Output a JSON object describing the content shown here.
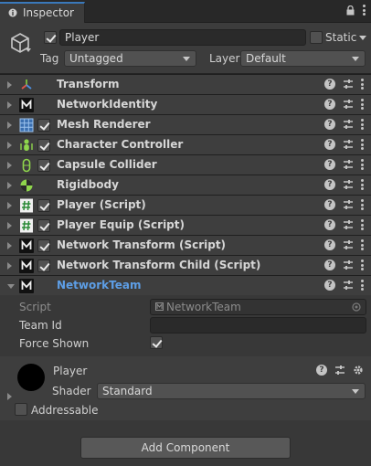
{
  "tab": {
    "label": "Inspector"
  },
  "header": {
    "object_name": "Player",
    "static_label": "Static",
    "tag_label": "Tag",
    "tag_value": "Untagged",
    "layer_label": "Layer",
    "layer_value": "Default",
    "active_checked": true,
    "static_checked": false
  },
  "components": [
    {
      "name": "Transform",
      "icon": "transform-icon",
      "checkbox": null
    },
    {
      "name": "NetworkIdentity",
      "icon": "mirror-icon",
      "checkbox": null
    },
    {
      "name": "Mesh Renderer",
      "icon": "mesh-renderer-icon",
      "checkbox": true
    },
    {
      "name": "Character Controller",
      "icon": "character-controller-icon",
      "checkbox": true
    },
    {
      "name": "Capsule Collider",
      "icon": "capsule-collider-icon",
      "checkbox": true
    },
    {
      "name": "Rigidbody",
      "icon": "rigidbody-icon",
      "checkbox": null
    },
    {
      "name": "Player (Script)",
      "icon": "script-icon",
      "checkbox": true
    },
    {
      "name": "Player Equip (Script)",
      "icon": "script-icon",
      "checkbox": true
    },
    {
      "name": "Network Transform (Script)",
      "icon": "mirror-icon",
      "checkbox": true
    },
    {
      "name": "Network Transform Child (Script)",
      "icon": "mirror-icon",
      "checkbox": true
    },
    {
      "name": "NetworkTeam",
      "icon": "mirror-icon",
      "checkbox": null,
      "expanded": true
    }
  ],
  "network_team": {
    "script_label": "Script",
    "script_value": "NetworkTeam",
    "team_id_label": "Team Id",
    "team_id_value": "",
    "force_shown_label": "Force Shown",
    "force_shown_checked": true
  },
  "material": {
    "name": "Player",
    "shader_label": "Shader",
    "shader_value": "Standard",
    "addressable_label": "Addressable"
  },
  "footer": {
    "add_component_label": "Add Component"
  },
  "colors": {
    "accent": "#3a79bb",
    "link_text": "#5d9ee6",
    "panel": "#3e3e3e",
    "background": "#383838"
  }
}
